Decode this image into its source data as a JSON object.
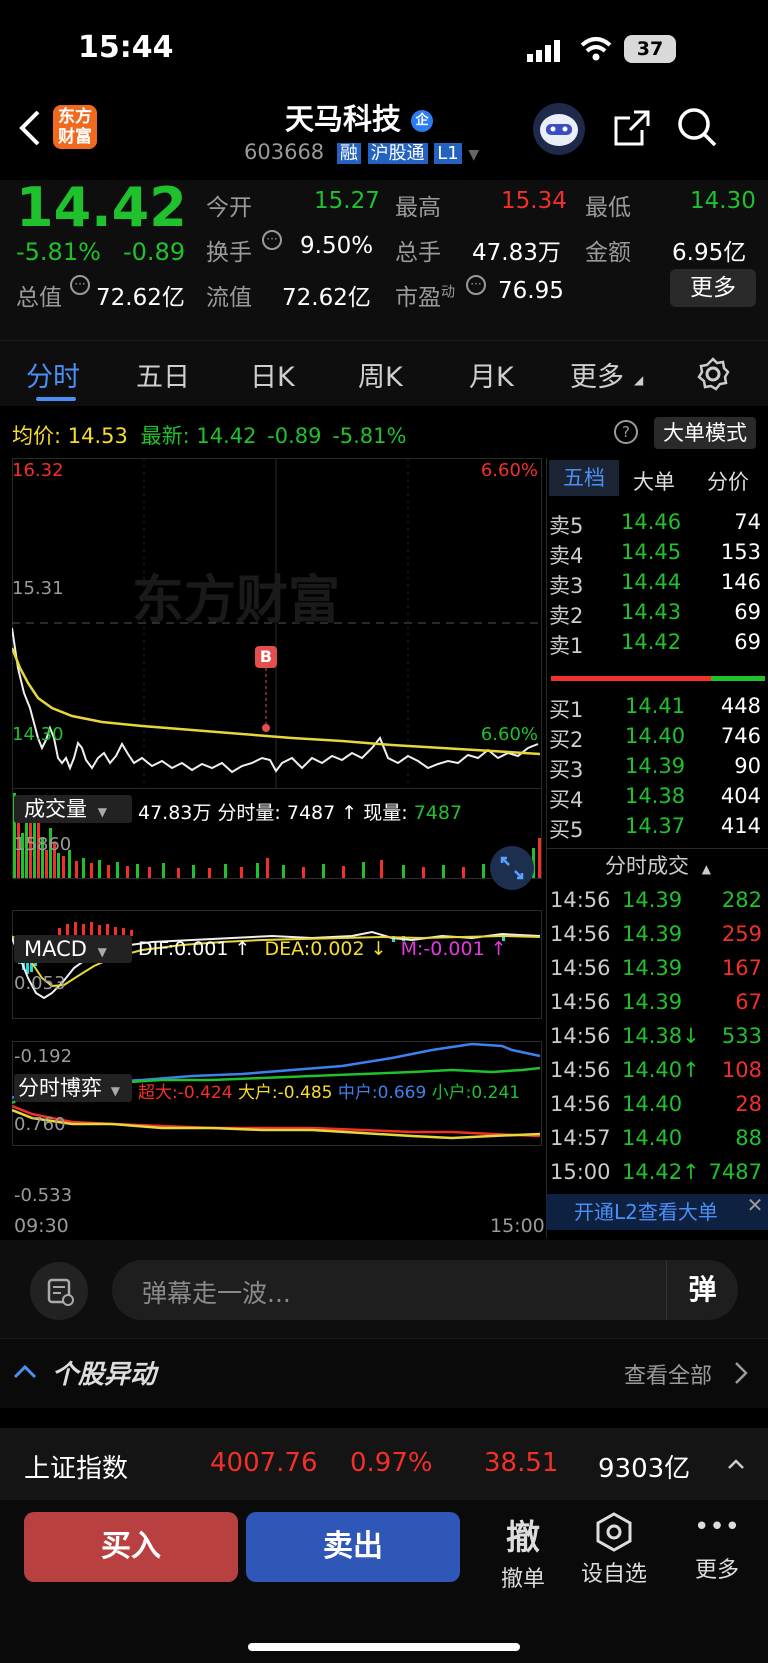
{
  "status": {
    "time": "15:44",
    "battery": "37"
  },
  "header": {
    "title": "天马科技",
    "code": "603668",
    "tag_rong": "融",
    "tag_hgt": "沪股通",
    "tag_l1": "L1",
    "logo_line1": "东方",
    "logo_line2": "财富"
  },
  "quote": {
    "price": "14.42",
    "change_pct": "-5.81%",
    "change": "-0.89",
    "open_label": "今开",
    "open": "15.27",
    "high_label": "最高",
    "high": "15.34",
    "low_label": "最低",
    "low": "14.30",
    "turnover_label": "换手",
    "turnover": "9.50%",
    "volume_label": "总手",
    "volume": "47.83万",
    "amount_label": "金额",
    "amount": "6.95亿",
    "mcap_label": "总值",
    "mcap": "72.62亿",
    "float_label": "流值",
    "float": "72.62亿",
    "pe_label": "市盈",
    "pe_sup": "动",
    "pe": "76.95",
    "more": "更多"
  },
  "tabs": [
    "分时",
    "五日",
    "日K",
    "周K",
    "月K",
    "更多"
  ],
  "info": {
    "avg_label": "均价:",
    "avg": "14.53",
    "last_label": "最新:",
    "last": "14.42",
    "chg": "-0.89",
    "pct": "-5.81%",
    "bigorder": "大单模式"
  },
  "chart": {
    "ymax": "16.32",
    "ymin": "14.30",
    "pmax": "6.60%",
    "pmin": "6.60%",
    "prev_close": "15.31",
    "watermark": "东方财富",
    "marker": "B",
    "vol_label": "成交量",
    "vol_text": "47.83万 分时量: 7487 ↑ 现量:",
    "vol_now": "7487",
    "vol_max": "15860",
    "macd_label": "MACD",
    "dif": "DIF:0.001 ↑",
    "dea": "DEA:0.002 ↓",
    "m": "M:-0.001 ↑",
    "macd_top": "0.053",
    "macd_bot": "-0.192",
    "game_label": "分时博弈",
    "super": "超大:-0.424",
    "big": "大户:-0.485",
    "mid": "中户:0.669",
    "small": "小户:0.241",
    "game_top": "0.760",
    "game_bot": "-0.533",
    "t_start": "09:30",
    "t_end": "15:00"
  },
  "orderbook": {
    "tabs": [
      "五档",
      "大单",
      "分价"
    ],
    "asks": [
      {
        "l": "卖5",
        "p": "14.46",
        "v": "74"
      },
      {
        "l": "卖4",
        "p": "14.45",
        "v": "153"
      },
      {
        "l": "卖3",
        "p": "14.44",
        "v": "146"
      },
      {
        "l": "卖2",
        "p": "14.43",
        "v": "69"
      },
      {
        "l": "卖1",
        "p": "14.42",
        "v": "69"
      }
    ],
    "bids": [
      {
        "l": "买1",
        "p": "14.41",
        "v": "448"
      },
      {
        "l": "买2",
        "p": "14.40",
        "v": "746"
      },
      {
        "l": "买3",
        "p": "14.39",
        "v": "90"
      },
      {
        "l": "买4",
        "p": "14.38",
        "v": "404"
      },
      {
        "l": "买5",
        "p": "14.37",
        "v": "414"
      }
    ],
    "ticks_title": "分时成交",
    "ticks": [
      {
        "t": "14:56",
        "p": "14.39",
        "v": "282"
      },
      {
        "t": "14:56",
        "p": "14.39",
        "v": "259"
      },
      {
        "t": "14:56",
        "p": "14.39",
        "v": "167"
      },
      {
        "t": "14:56",
        "p": "14.39",
        "v": "67"
      },
      {
        "t": "14:56",
        "p": "14.38↓",
        "v": "533"
      },
      {
        "t": "14:56",
        "p": "14.40↑",
        "v": "108"
      },
      {
        "t": "14:56",
        "p": "14.40",
        "v": "28"
      },
      {
        "t": "14:57",
        "p": "14.40",
        "v": "88"
      },
      {
        "t": "15:00",
        "p": "14.42↑",
        "v": "7487"
      }
    ],
    "l2": "开通L2查看大单"
  },
  "danmu": {
    "placeholder": "弹幕走一波...",
    "btn": "弹"
  },
  "news": {
    "title": "个股异动",
    "more": "查看全部"
  },
  "index": {
    "name": "上证指数",
    "value": "4007.76",
    "pct": "0.97%",
    "chg": "38.51",
    "amount": "9303亿"
  },
  "actions": {
    "buy": "买入",
    "sell": "卖出",
    "cancel": "撤单",
    "cancel_icon": "撤",
    "watch": "设自选",
    "more": "更多"
  },
  "colors": {
    "up": "#f2302a",
    "down": "#1fc12c",
    "avg": "#f5dd2c",
    "buy_btn": "#b94040",
    "sell_btn": "#2e57b8"
  }
}
